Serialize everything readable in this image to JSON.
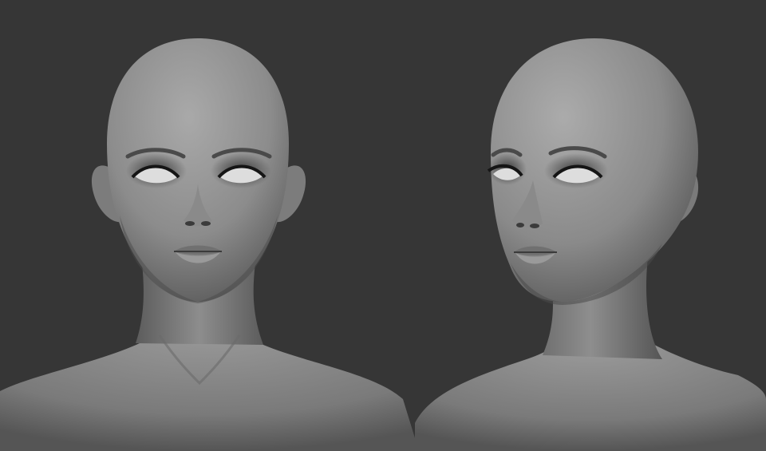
{
  "scene": {
    "background_color": "#363636",
    "shade_light": "#a9a9a9",
    "shade_mid": "#7f7f7f",
    "shade_dark": "#3b3b3b",
    "eye_color": "#dddddd",
    "lash_color": "#151515"
  },
  "renders": [
    {
      "view": "front"
    },
    {
      "view": "three-quarter"
    }
  ]
}
